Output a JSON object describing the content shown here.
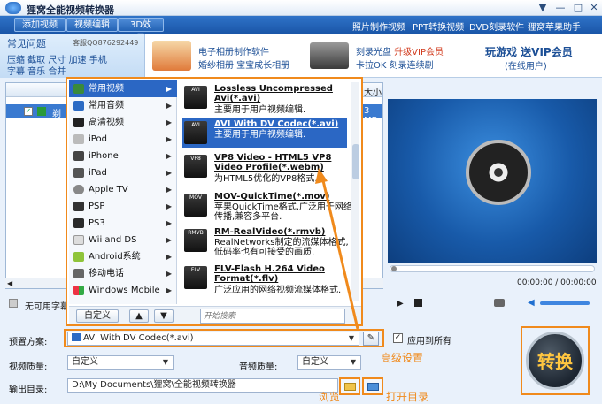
{
  "window": {
    "title": "狸窝全能视频转换器"
  },
  "toolbar": {
    "add_video": "添加视频",
    "edit_video": "视频编辑",
    "effect_3d": "3D效果",
    "links": [
      "照片制作视频",
      "PPT转换视频",
      "DVD刻录软件",
      "狸窝苹果助手"
    ]
  },
  "banner": {
    "faq_title": "常见问题",
    "qq": "客服QQ876292449",
    "faq_row1": "压缩 截取 尺寸 加速 手机",
    "faq_row2": "字幕 音乐 合并",
    "ad1_line1": "电子相册制作软件",
    "ad1_line2": "婚纱相册 宝宝成长相册",
    "ad2_line1": "刻录光盘",
    "ad2_line1_red": "升级VIP会员",
    "ad2_line2": "卡拉OK 刻录连续剧",
    "ad3_line1": "玩游戏 送VIP会员",
    "ad3_line2": "(在线用户)"
  },
  "filelist": {
    "col_size": "大小",
    "row_name": "剃",
    "row_size": "3 MB"
  },
  "subtitle": {
    "label": "无可用字幕"
  },
  "dropdown": {
    "categories": [
      {
        "label": "常用视频",
        "icon": "video-icon",
        "selected": true
      },
      {
        "label": "常用音频",
        "icon": "audio-icon",
        "selected": false
      },
      {
        "label": "高清视频",
        "icon": "hd-video-icon",
        "selected": false
      },
      {
        "label": "iPod",
        "icon": "ipod-icon",
        "selected": false
      },
      {
        "label": "iPhone",
        "icon": "iphone-icon",
        "selected": false
      },
      {
        "label": "iPad",
        "icon": "ipad-icon",
        "selected": false
      },
      {
        "label": "Apple TV",
        "icon": "apple-tv-icon",
        "selected": false
      },
      {
        "label": "PSP",
        "icon": "psp-icon",
        "selected": false
      },
      {
        "label": "PS3",
        "icon": "ps3-icon",
        "selected": false
      },
      {
        "label": "Wii and DS",
        "icon": "wii-icon",
        "selected": false
      },
      {
        "label": "Android系统",
        "icon": "android-icon",
        "selected": false
      },
      {
        "label": "移动电话",
        "icon": "mobile-phone-icon",
        "selected": false
      },
      {
        "label": "Windows Mobile",
        "icon": "windows-icon",
        "selected": false
      }
    ],
    "formats": [
      {
        "icon_text": "AVI",
        "title": "Lossless Uncompressed Avi(*.avi)",
        "desc": "主要用于用户视频编辑.",
        "selected": false
      },
      {
        "icon_text": "AVI",
        "title": "AVI With DV Codec(*.avi)",
        "desc": "主要用于用户视频编辑.",
        "selected": true
      },
      {
        "icon_text": "VP8",
        "title": "VP8 Video - HTML5 VP8 Video Profile(*.webm)",
        "desc": "为HTML5优化的VP8格式.",
        "selected": false
      },
      {
        "icon_text": "MOV",
        "title": "MOV-QuickTime(*.mov)",
        "desc": "苹果QuickTime格式,广泛用于网络传播,兼容多平台.",
        "selected": false
      },
      {
        "icon_text": "RMVB",
        "title": "RM-RealVideo(*.rmvb)",
        "desc": "RealNetworks制定的流媒体格式,低码率也有可接受的画质.",
        "selected": false
      },
      {
        "icon_text": "FLV",
        "title": "FLV-Flash H.264 Video Format(*.flv)",
        "desc": "广泛应用的网络视频流媒体格式.",
        "selected": false
      }
    ],
    "custom_button": "自定义",
    "search_placeholder": "开始搜索"
  },
  "preview": {
    "time": "00:00:00 / 00:00:00"
  },
  "form": {
    "preset_label": "预置方案:",
    "preset_value": "AVI With DV Codec(*.avi)",
    "apply_all": "应用到所有",
    "video_quality_label": "视频质量:",
    "video_quality_value": "自定义",
    "audio_quality_label": "音频质量:",
    "audio_quality_value": "自定义",
    "output_label": "输出目录:",
    "output_value": "D:\\My Documents\\狸窝\\全能视频转换器"
  },
  "annotations": {
    "advanced": "高级设置",
    "browse": "浏览",
    "open_dir": "打开目录"
  },
  "convert_button": "转换",
  "colors": {
    "accent_orange": "#f08a1c",
    "toolbar_blue": "#1a56a8",
    "selection_blue": "#2b67c4"
  }
}
